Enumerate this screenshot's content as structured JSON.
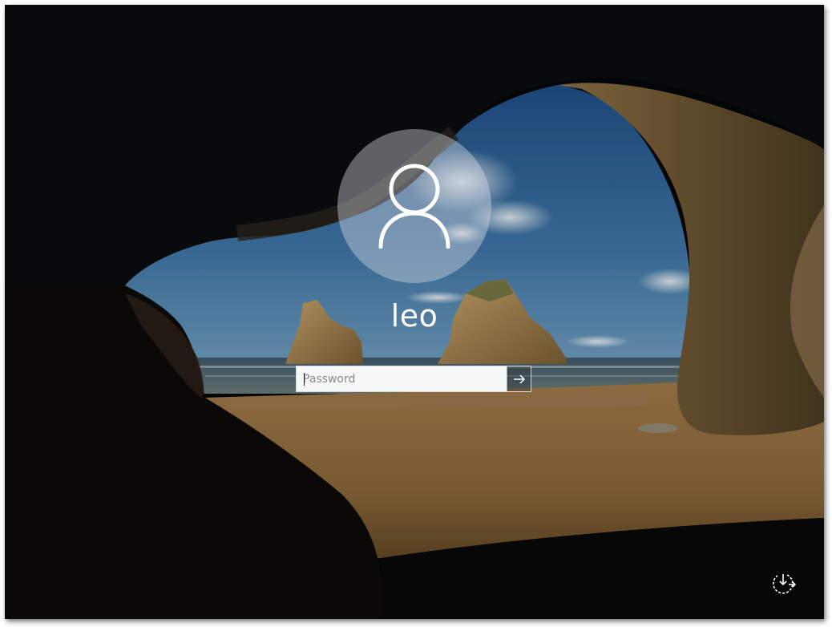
{
  "user": {
    "name": "leo",
    "avatar_icon": "user-silhouette-icon"
  },
  "password": {
    "placeholder": "Password",
    "value": "",
    "submit_icon": "arrow-right-icon"
  },
  "corner": {
    "icon": "ease-of-access-power-icon"
  },
  "colors": {
    "avatar_bg": "#d7dce4",
    "text": "#ffffff",
    "input_bg": "#f4f8f6"
  }
}
